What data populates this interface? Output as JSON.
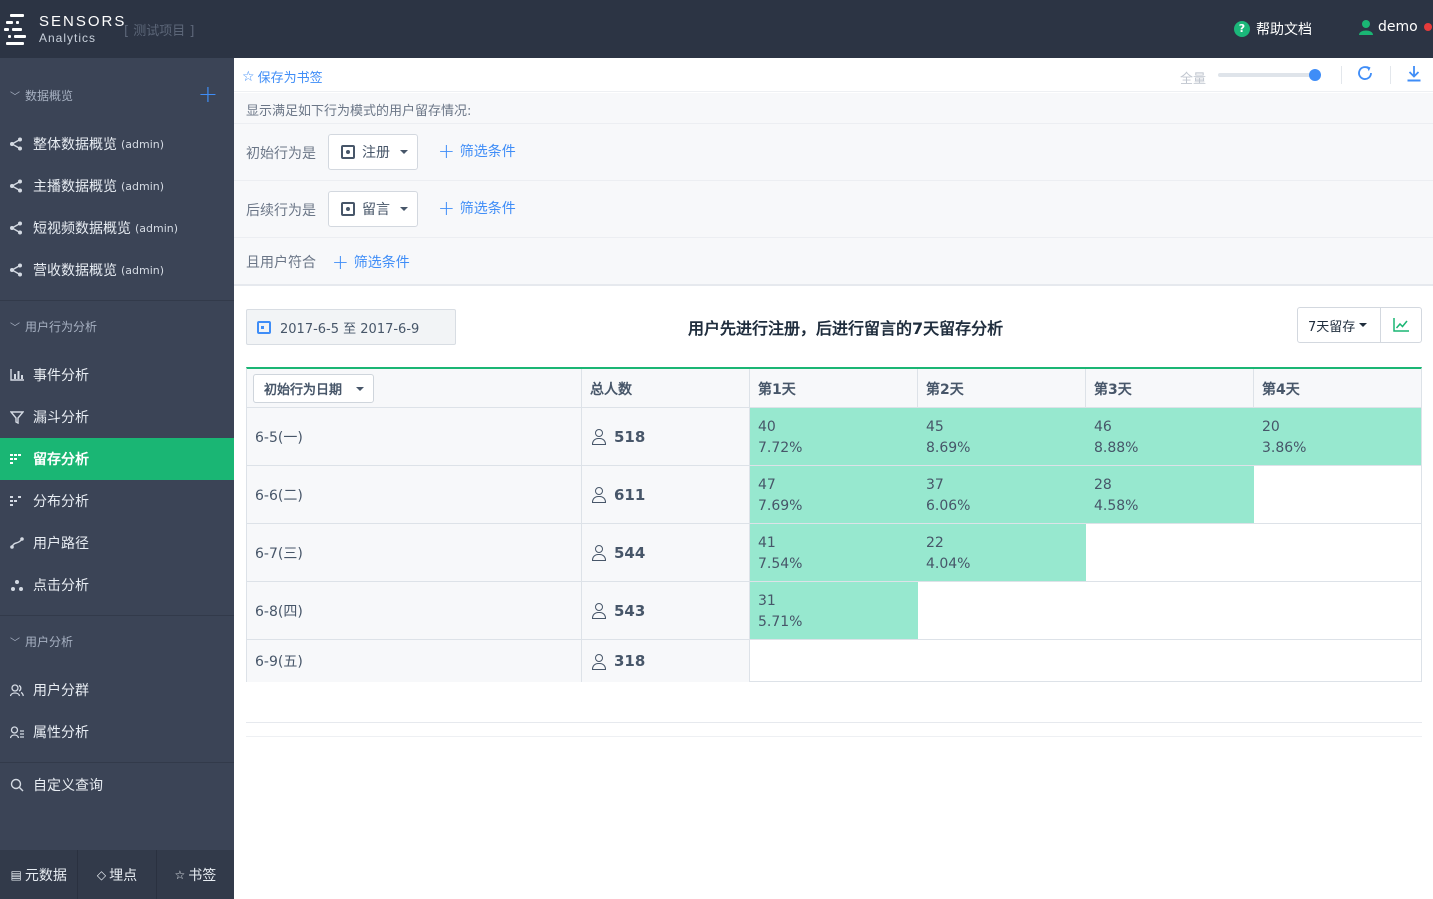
{
  "header": {
    "brand_line1": "SENSORS",
    "brand_line2": "Analytics",
    "project": "[ 测试项目 ]",
    "help": "帮助文档",
    "help_icon": "question-circle-icon",
    "user": "demo",
    "colors": {
      "topbar": "#2c3444",
      "accent": "#3f8df7",
      "active": "#1ab674"
    }
  },
  "sidebar": {
    "sections": [
      {
        "title": "数据概览",
        "items": [
          {
            "label": "整体数据概览",
            "suffix": "(admin)",
            "icon": "share-icon"
          },
          {
            "label": "主播数据概览",
            "suffix": "(admin)",
            "icon": "share-icon"
          },
          {
            "label": "短视频数据概览",
            "suffix": "(admin)",
            "icon": "share-icon"
          },
          {
            "label": "营收数据概览",
            "suffix": "(admin)",
            "icon": "share-icon"
          }
        ]
      },
      {
        "title": "用户行为分析",
        "items": [
          {
            "label": "事件分析",
            "icon": "bar-chart-icon"
          },
          {
            "label": "漏斗分析",
            "icon": "funnel-icon"
          },
          {
            "label": "留存分析",
            "icon": "retention-icon",
            "active": true
          },
          {
            "label": "分布分析",
            "icon": "distribution-icon"
          },
          {
            "label": "用户路径",
            "icon": "path-icon"
          },
          {
            "label": "点击分析",
            "icon": "click-icon"
          }
        ]
      },
      {
        "title": "用户分析",
        "items": [
          {
            "label": "用户分群",
            "icon": "users-icon"
          },
          {
            "label": "属性分析",
            "icon": "user-attr-icon"
          }
        ]
      },
      {
        "title": "",
        "items": [
          {
            "label": "自定义查询",
            "icon": "search-icon"
          }
        ]
      }
    ],
    "bottom": [
      {
        "label": "元数据",
        "icon": "metadata-icon"
      },
      {
        "label": "埋点",
        "icon": "tracking-icon"
      },
      {
        "label": "书签",
        "icon": "star-icon"
      }
    ]
  },
  "toolbar": {
    "bookmark": "保存为书签",
    "sampling_label": "全量",
    "sampling_level": 1.0
  },
  "conditions": {
    "description": "显示满足如下行为模式的用户留存情况:",
    "initial_label": "初始行为是",
    "initial_event": "注册",
    "followup_label": "后续行为是",
    "followup_event": "留言",
    "user_label": "且用户符合",
    "filter": "筛选条件"
  },
  "report": {
    "date_range": "2017-6-5 至 2017-6-9",
    "title": "用户先进行注册，后进行留言的7天留存分析",
    "retention_select": "7天留存",
    "table": {
      "date_select": "初始行为日期",
      "col_total": "总人数",
      "col_days": [
        "第1天",
        "第2天",
        "第3天",
        "第4天"
      ],
      "rows": [
        {
          "date": "6-5(一)",
          "total": "518",
          "cells": [
            [
              "40",
              "7.72%"
            ],
            [
              "45",
              "8.69%"
            ],
            [
              "46",
              "8.88%"
            ],
            [
              "20",
              "3.86%"
            ]
          ]
        },
        {
          "date": "6-6(二)",
          "total": "611",
          "cells": [
            [
              "47",
              "7.69%"
            ],
            [
              "37",
              "6.06%"
            ],
            [
              "28",
              "4.58%"
            ]
          ]
        },
        {
          "date": "6-7(三)",
          "total": "544",
          "cells": [
            [
              "41",
              "7.54%"
            ],
            [
              "22",
              "4.04%"
            ]
          ]
        },
        {
          "date": "6-8(四)",
          "total": "543",
          "cells": [
            [
              "31",
              "5.71%"
            ]
          ]
        },
        {
          "date": "6-9(五)",
          "total": "318",
          "cells": []
        }
      ]
    }
  }
}
